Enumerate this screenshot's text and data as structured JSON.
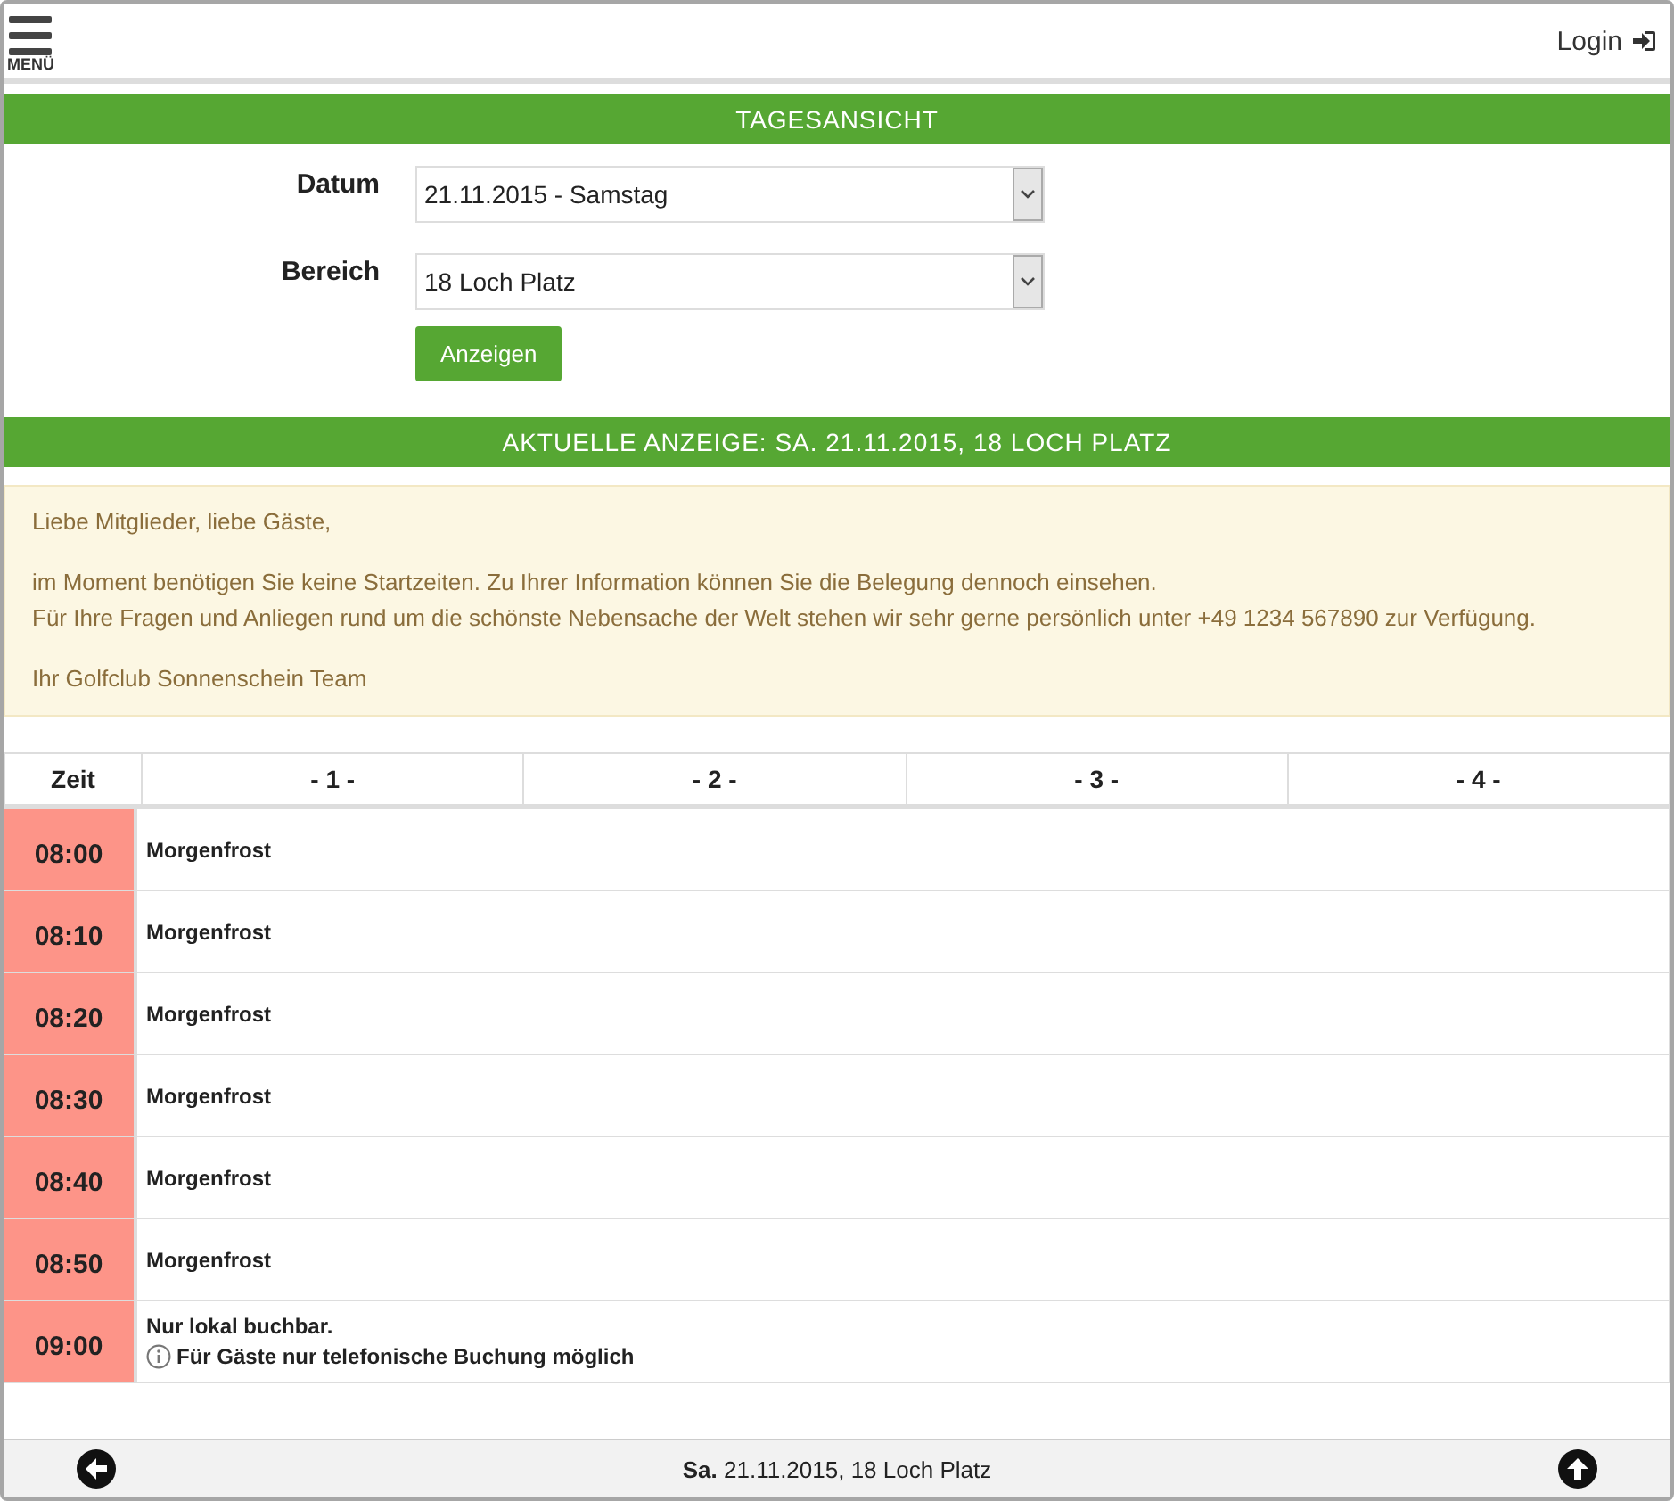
{
  "header": {
    "menu_label": "MENÜ",
    "login": "Login"
  },
  "title_bar": "TAGESANSICHT",
  "form": {
    "fields": [
      {
        "label": "Datum",
        "value": "21.11.2015 - Samstag"
      },
      {
        "label": "Bereich",
        "value": "18 Loch Platz"
      }
    ],
    "button": "Anzeigen"
  },
  "current_bar": "AKTUELLE ANZEIGE: SA. 21.11.2015, 18 LOCH PLATZ",
  "notice": [
    "Liebe Mitglieder, liebe Gäste,",
    "im Moment benötigen Sie keine Startzeiten. Zu Ihrer Information können Sie die Belegung dennoch einsehen.",
    "Für Ihre Fragen und Anliegen rund um die schönste Nebensache der Welt stehen wir sehr gerne persönlich unter +49 1234 567890 zur Verfügung.",
    "Ihr Golfclub Sonnenschein Team"
  ],
  "table": {
    "columns": [
      "Zeit",
      "- 1 -",
      "- 2 -",
      "- 3 -",
      "- 4 -"
    ],
    "rows": [
      {
        "time": "08:00",
        "color": "#fd9488",
        "text": "Morgenfrost"
      },
      {
        "time": "08:10",
        "color": "#fd9488",
        "text": "Morgenfrost"
      },
      {
        "time": "08:20",
        "color": "#fd9488",
        "text": "Morgenfrost"
      },
      {
        "time": "08:30",
        "color": "#fd9488",
        "text": "Morgenfrost"
      },
      {
        "time": "08:40",
        "color": "#fd9488",
        "text": "Morgenfrost"
      },
      {
        "time": "08:50",
        "color": "#fd9488",
        "text": "Morgenfrost"
      },
      {
        "time": "09:00",
        "color": "#fd9488",
        "text": "Nur lokal buchbar.",
        "note": "Für Gäste nur telefonische Buchung möglich"
      }
    ]
  },
  "footer": "**Sa.** 21.11.2015, 18 Loch Platz"
}
